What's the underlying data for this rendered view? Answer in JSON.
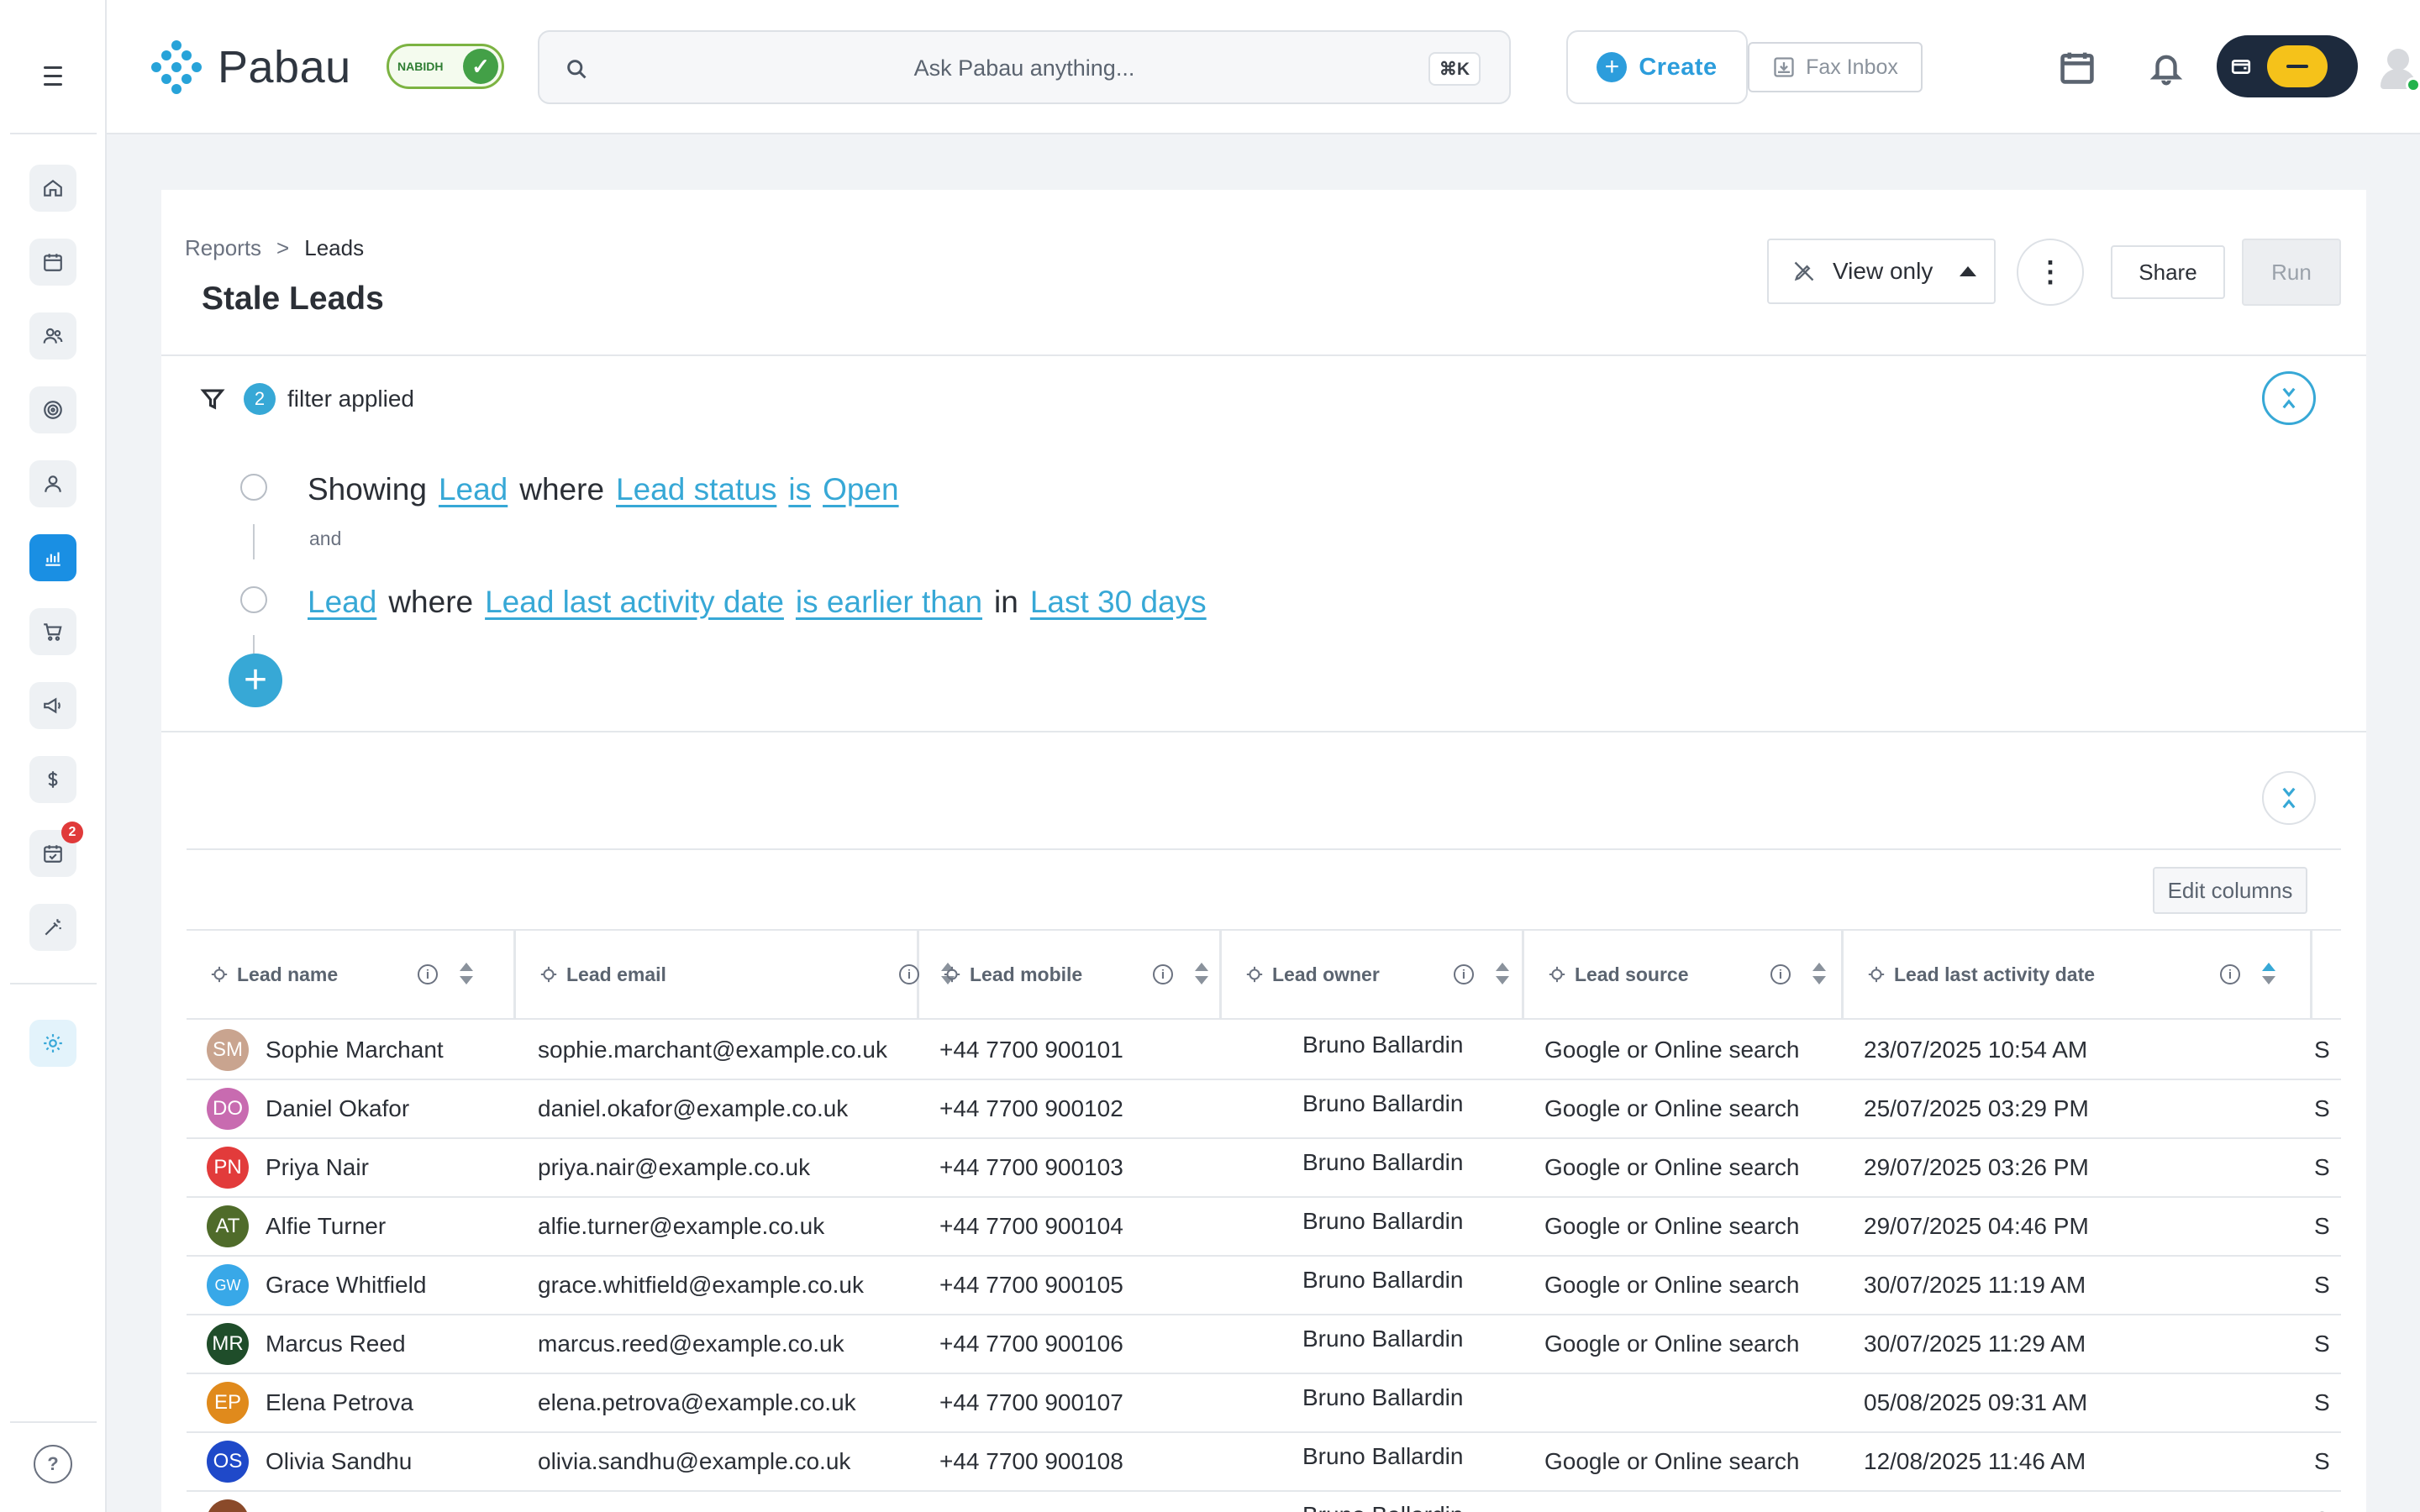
{
  "app": {
    "logo_text": "Pabau",
    "badge_text": "NABIDH",
    "search_placeholder": "Ask Pabau anything...",
    "search_shortcut": "⌘K",
    "create_label": "Create",
    "fax_label": "Fax Inbox",
    "colors": {
      "accent": "#37a8d6",
      "active_nav": "#1a8fe3",
      "dark_pill": "#1d2a3d",
      "yellow": "#f5c21a",
      "online": "#22b24c",
      "badge_red": "#e03a3a"
    }
  },
  "sidebar": {
    "items": [
      {
        "icon": "home-icon"
      },
      {
        "icon": "calendar-icon"
      },
      {
        "icon": "contacts-icon"
      },
      {
        "icon": "target-icon"
      },
      {
        "icon": "user-icon"
      },
      {
        "icon": "reports-icon",
        "active": true
      },
      {
        "icon": "cart-icon"
      },
      {
        "icon": "megaphone-icon"
      },
      {
        "icon": "dollar-icon"
      },
      {
        "icon": "tasks-icon",
        "badge": "2"
      },
      {
        "icon": "magic-wand-icon"
      },
      {
        "icon": "settings-sun-icon"
      }
    ],
    "help_glyph": "?"
  },
  "page": {
    "breadcrumb": {
      "root": "Reports",
      "sep": ">",
      "current": "Leads"
    },
    "title": "Stale Leads",
    "view_mode": "View only",
    "more_glyph": "⋮",
    "share_label": "Share",
    "run_label": "Run"
  },
  "filters": {
    "count": "2",
    "summary": "filter applied",
    "connector": "and",
    "rule1": {
      "prefix": "Showing",
      "entity": "Lead",
      "where": "where",
      "field": "Lead status",
      "op": "is",
      "value": "Open"
    },
    "rule2": {
      "entity": "Lead",
      "where": "where",
      "field": "Lead last activity date",
      "op": "is earlier than",
      "in": "in",
      "value": "Last 30 days"
    },
    "add_glyph": "+"
  },
  "table": {
    "edit_columns_label": "Edit columns",
    "columns": [
      "Lead name",
      "Lead email",
      "Lead mobile",
      "Lead owner",
      "Lead source",
      "Lead last activity date"
    ],
    "sorted_column": "Lead last activity date",
    "sort_direction": "ascending",
    "rows": [
      {
        "initials": "SM",
        "color": "#c9a48f",
        "name": "Sophie Marchant",
        "email": "sophie.marchant@example.co.uk",
        "mobile": "+44 7700 900101",
        "owner": "Bruno Ballardin",
        "source": "Google or Online search",
        "last_activity": "23/07/2025 10:54 AM"
      },
      {
        "initials": "DO",
        "color": "#c86bb0",
        "name": "Daniel Okafor",
        "email": "daniel.okafor@example.co.uk",
        "mobile": "+44 7700 900102",
        "owner": "Bruno Ballardin",
        "source": "Google or Online search",
        "last_activity": "25/07/2025 03:29 PM"
      },
      {
        "initials": "PN",
        "color": "#e23b3b",
        "name": "Priya Nair",
        "email": "priya.nair@example.co.uk",
        "mobile": "+44 7700 900103",
        "owner": "Bruno Ballardin",
        "source": "Google or Online search",
        "last_activity": "29/07/2025 03:26 PM"
      },
      {
        "initials": "AT",
        "color": "#4f6b2a",
        "name": "Alfie Turner",
        "email": "alfie.turner@example.co.uk",
        "mobile": "+44 7700 900104",
        "owner": "Bruno Ballardin",
        "source": "Google or Online search",
        "last_activity": "29/07/2025 04:46 PM"
      },
      {
        "initials": "GW",
        "color": "#38a8e8",
        "name": "Grace Whitfield",
        "email": "grace.whitfield@example.co.uk",
        "mobile": "+44 7700 900105",
        "owner": "Bruno Ballardin",
        "source": "Google or Online search",
        "last_activity": "30/07/2025 11:19 AM"
      },
      {
        "initials": "MR",
        "color": "#1f4d2a",
        "name": "Marcus Reed",
        "email": "marcus.reed@example.co.uk",
        "mobile": "+44 7700 900106",
        "owner": "Bruno Ballardin",
        "source": "Google or Online search",
        "last_activity": "30/07/2025 11:29 AM"
      },
      {
        "initials": "EP",
        "color": "#e08a1c",
        "name": "Elena Petrova",
        "email": "elena.petrova@example.co.uk",
        "mobile": "+44 7700 900107",
        "owner": "Bruno Ballardin",
        "source": "",
        "last_activity": "05/08/2025 09:31 AM"
      },
      {
        "initials": "OS",
        "color": "#1f49c9",
        "name": "Olivia Sandhu",
        "email": "olivia.sandhu@example.co.uk",
        "mobile": "+44 7700 900108",
        "owner": "Bruno Ballardin",
        "source": "Google or Online search",
        "last_activity": "12/08/2025 11:46 AM"
      },
      {
        "initials": "",
        "color": "#8a4a2a",
        "name": "",
        "email": "",
        "mobile": "",
        "owner": "Bruno Ballardin",
        "source": "",
        "last_activity": ""
      }
    ]
  }
}
